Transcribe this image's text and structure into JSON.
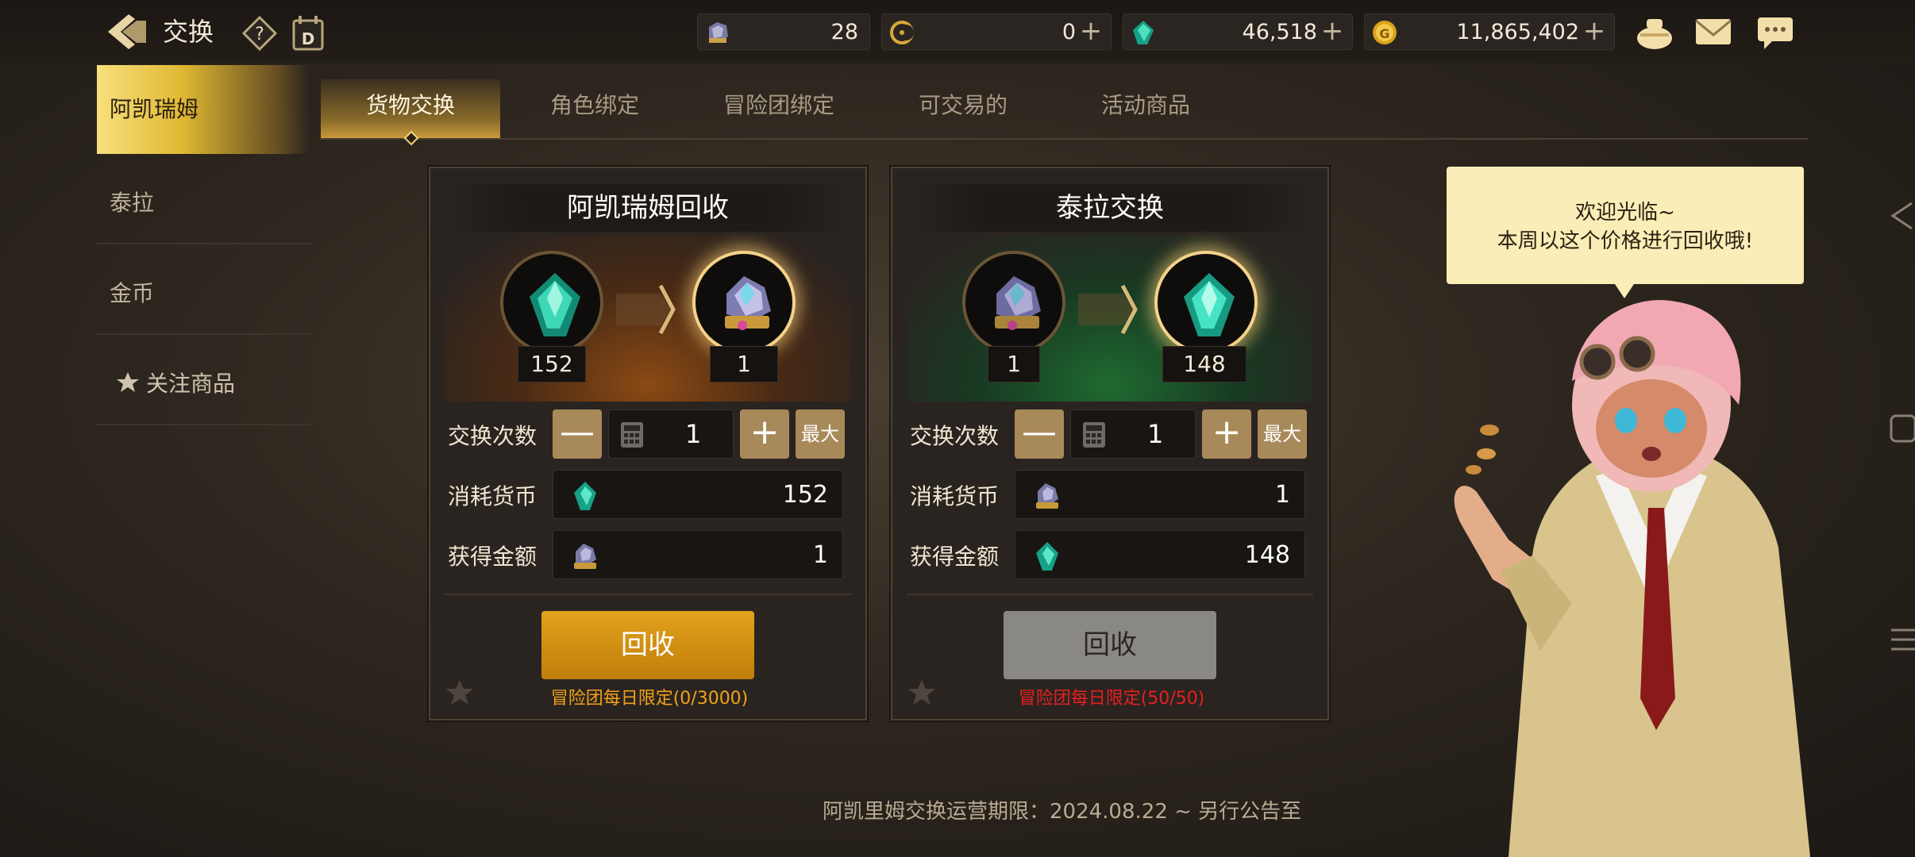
{
  "header": {
    "title": "交换",
    "currencies": [
      {
        "icon": "fragment-crystal-icon",
        "value": "28",
        "has_plus": false
      },
      {
        "icon": "moon-coin-icon",
        "value": "0",
        "has_plus": true
      },
      {
        "icon": "green-gem-icon",
        "value": "46,518",
        "has_plus": true
      },
      {
        "icon": "gold-coin-icon",
        "value": "11,865,402",
        "has_plus": true
      }
    ],
    "plus_symbol": "+"
  },
  "sidebar": {
    "items": [
      {
        "label": "阿凯瑞姆",
        "active": true
      },
      {
        "label": "泰拉",
        "active": false
      },
      {
        "label": "金币",
        "active": false
      },
      {
        "label": "关注商品",
        "active": false
      }
    ]
  },
  "tabs": [
    {
      "label": "货物交换",
      "active": true
    },
    {
      "label": "角色绑定",
      "active": false
    },
    {
      "label": "冒险团绑定",
      "active": false
    },
    {
      "label": "可交易的",
      "active": false
    },
    {
      "label": "活动商品",
      "active": false
    }
  ],
  "panels": [
    {
      "title": "阿凯瑞姆回收",
      "from_qty": "152",
      "to_qty": "1",
      "count_label": "交换次数",
      "count_value": "1",
      "minus": "—",
      "plus": "+",
      "max_label": "最大",
      "cost_label": "消耗货币",
      "cost_value": "152",
      "gain_label": "获得金额",
      "gain_value": "1",
      "button_label": "回收",
      "limit_text": "冒险团每日限定(0/3000)",
      "limit_color": "#f0a21a"
    },
    {
      "title": "泰拉交换",
      "from_qty": "1",
      "to_qty": "148",
      "count_label": "交换次数",
      "count_value": "1",
      "minus": "—",
      "plus": "+",
      "max_label": "最大",
      "cost_label": "消耗货币",
      "cost_value": "1",
      "gain_label": "获得金额",
      "gain_value": "148",
      "button_label": "回收",
      "limit_text": "冒险团每日限定(50/50)",
      "limit_color": "#e62020"
    }
  ],
  "npc": {
    "line1": "欢迎光临~",
    "line2": "本周以这个价格进行回收哦!"
  },
  "footer": {
    "text": "阿凯里姆交换运营期限：2024.08.22 ~ 另行公告至"
  }
}
